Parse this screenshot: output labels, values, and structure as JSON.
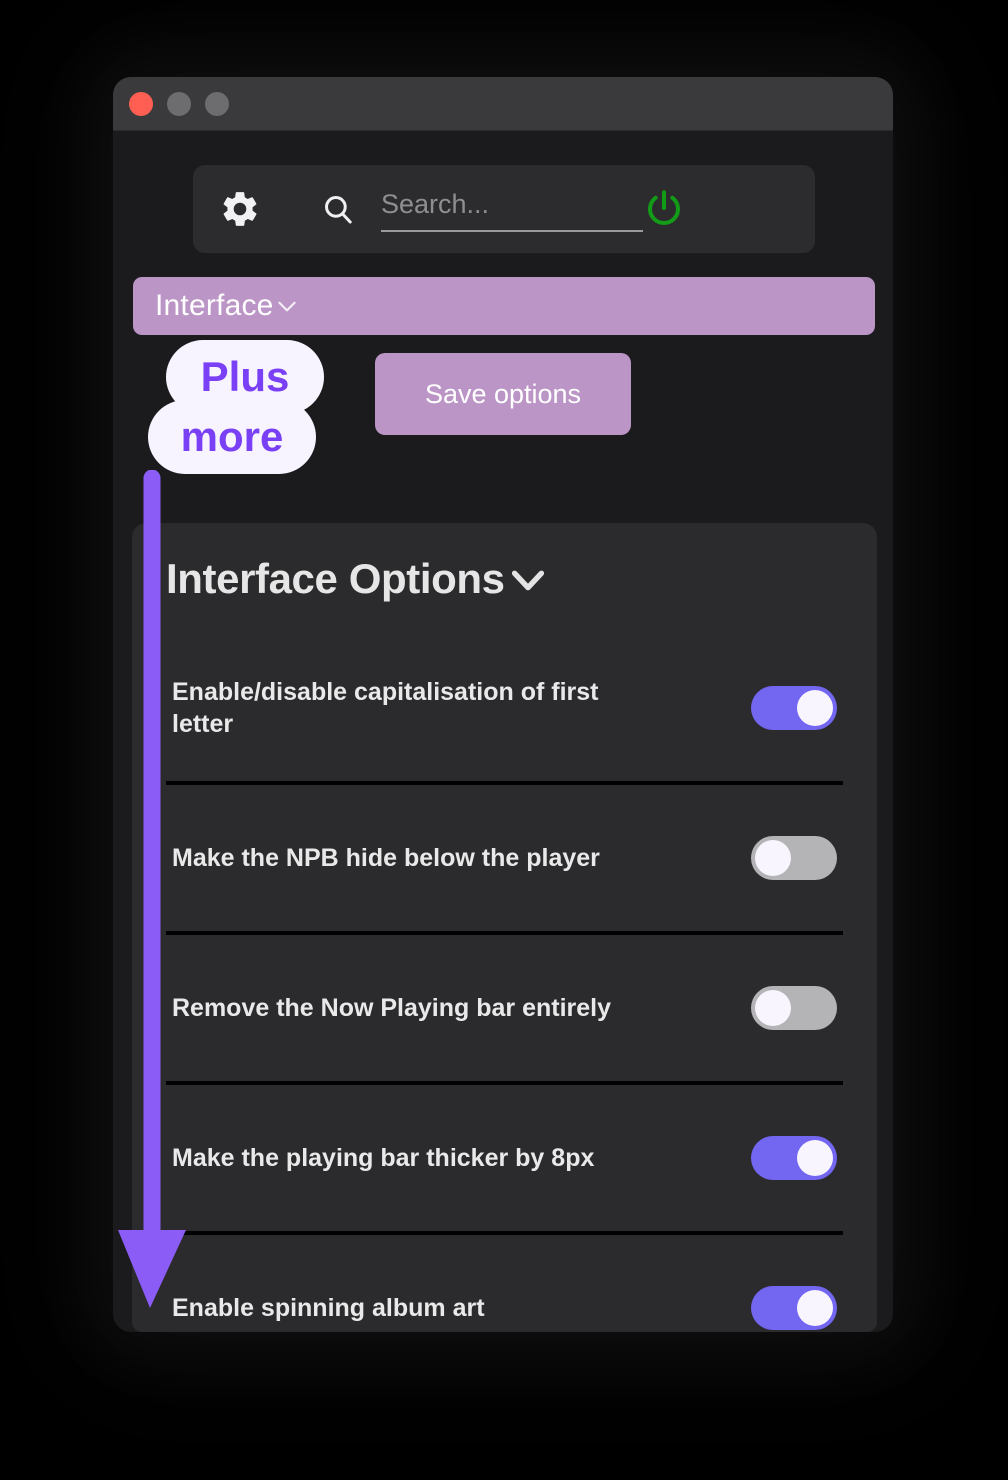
{
  "window": {
    "traffic_lights": [
      "close",
      "minimize",
      "maximize"
    ]
  },
  "toolbar": {
    "gear_icon": "gear-icon",
    "search_icon": "search-icon",
    "search_value": "",
    "search_placeholder": "Search...",
    "power_icon": "power-icon",
    "power_color": "#119b16"
  },
  "dropdown": {
    "selected": "Interface",
    "chevron_icon": "chevron-down-icon",
    "bg_color": "#bb95c5"
  },
  "actions": {
    "save_label": "Save options"
  },
  "panel": {
    "title": "Interface Options",
    "collapse_icon": "chevron-down-icon",
    "options": [
      {
        "label": "Enable/disable capitalisation of first letter",
        "state": "on"
      },
      {
        "label": "Make the NPB hide below the player",
        "state": "off"
      },
      {
        "label": "Remove the Now Playing bar entirely",
        "state": "off"
      },
      {
        "label": "Make the playing bar thicker by 8px",
        "state": "on"
      },
      {
        "label": "Enable spinning album art",
        "state": "on"
      }
    ]
  },
  "annotations": {
    "badge_line_1": "Plus",
    "badge_line_2": "more",
    "badge_text_color": "#7a40f5",
    "badge_bg_color": "#f8f4ff",
    "arrow_color": "#8b5cf6",
    "arrow_direction": "down"
  },
  "colors": {
    "toggle_on": "#7366f0",
    "toggle_off": "#b4b4b6",
    "accent": "#bb95c5",
    "window_bg": "#1b1b1d",
    "panel_bg": "#2b2b2d",
    "titlebar_bg": "#3a3a3c",
    "close_dot": "#ff5f52"
  }
}
